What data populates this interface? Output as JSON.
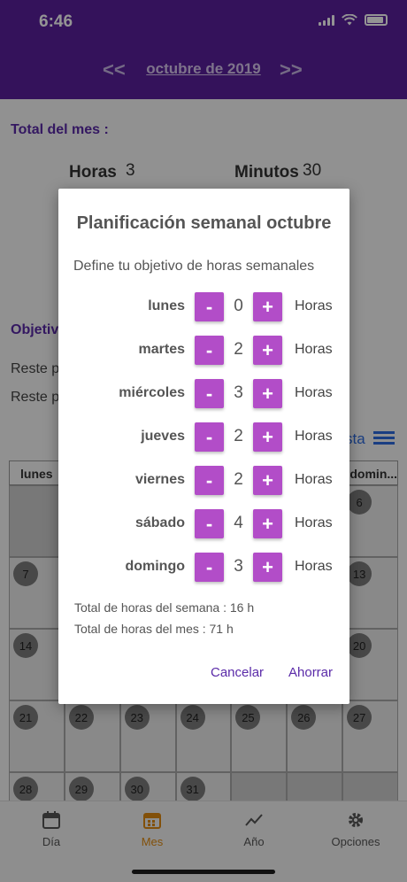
{
  "status": {
    "time": "6:46"
  },
  "header": {
    "prev_arrow": "<<",
    "month": "octubre de 2019",
    "next_arrow": ">>",
    "bg_color": "#5a1f9e"
  },
  "summary": {
    "total_label": "Total del mes :",
    "hours_label": "Horas",
    "hours_value": "3",
    "minutes_label": "Minutos",
    "minutes_value": "30",
    "objective_label": "Objetiv",
    "reste1": "Reste p",
    "reste2": "Reste p",
    "list_label": "sta"
  },
  "calendar": {
    "headers": [
      "lunes",
      "",
      "",
      "",
      "",
      "",
      "domin..."
    ],
    "rows": [
      [
        "",
        "",
        "",
        "",
        "",
        "",
        "6"
      ],
      [
        "7",
        "",
        "",
        "",
        "",
        "",
        "13"
      ],
      [
        "14",
        "",
        "",
        "",
        "",
        "",
        "20"
      ],
      [
        "21",
        "22",
        "23",
        "24",
        "25",
        "26",
        "27"
      ],
      [
        "28",
        "29",
        "30",
        "31",
        "",
        "",
        ""
      ]
    ]
  },
  "dialog": {
    "title": "Planificación semanal octubre",
    "subtitle": "Define tu objetivo de horas semanales",
    "minus_label": "-",
    "plus_label": "+",
    "unit_label": "Horas",
    "days": [
      {
        "name": "lunes",
        "value": "0"
      },
      {
        "name": "martes",
        "value": "2"
      },
      {
        "name": "miércoles",
        "value": "3"
      },
      {
        "name": "jueves",
        "value": "2"
      },
      {
        "name": "viernes",
        "value": "2"
      },
      {
        "name": "sábado",
        "value": "4"
      },
      {
        "name": "domingo",
        "value": "3"
      }
    ],
    "total_week": "Total de horas del semana :  16 h",
    "total_month": "Total de horas del mes :  71 h",
    "cancel_label": "Cancelar",
    "save_label": "Ahorrar",
    "accent_color": "#b24dc8"
  },
  "tabs": [
    {
      "label": "Día",
      "icon": "calendar-day-icon"
    },
    {
      "label": "Mes",
      "icon": "calendar-month-icon"
    },
    {
      "label": "Año",
      "icon": "trend-chart-icon"
    },
    {
      "label": "Opciones",
      "icon": "gear-icon"
    }
  ]
}
